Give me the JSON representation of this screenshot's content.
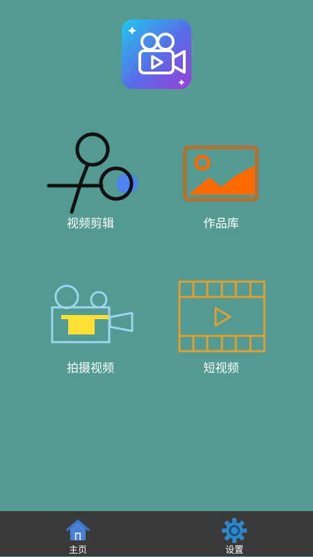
{
  "app": {
    "logo_icon": "video-camera-logo-icon"
  },
  "tiles": [
    {
      "label": "视频剪辑",
      "icon": "scissors-icon"
    },
    {
      "label": "作品库",
      "icon": "image-gallery-icon"
    },
    {
      "label": "拍摄视频",
      "icon": "camera-icon"
    },
    {
      "label": "短视频",
      "icon": "film-strip-play-icon"
    }
  ],
  "nav": {
    "home_label": "主页",
    "settings_label": "设置"
  },
  "colors": {
    "background": "#529a92",
    "nav_bar": "#3a3a3a",
    "works_orange": "#ff6a00",
    "film_gold": "#e0a030",
    "camera_blue": "#9fd6ef",
    "camera_yellow": "#ffe033"
  }
}
